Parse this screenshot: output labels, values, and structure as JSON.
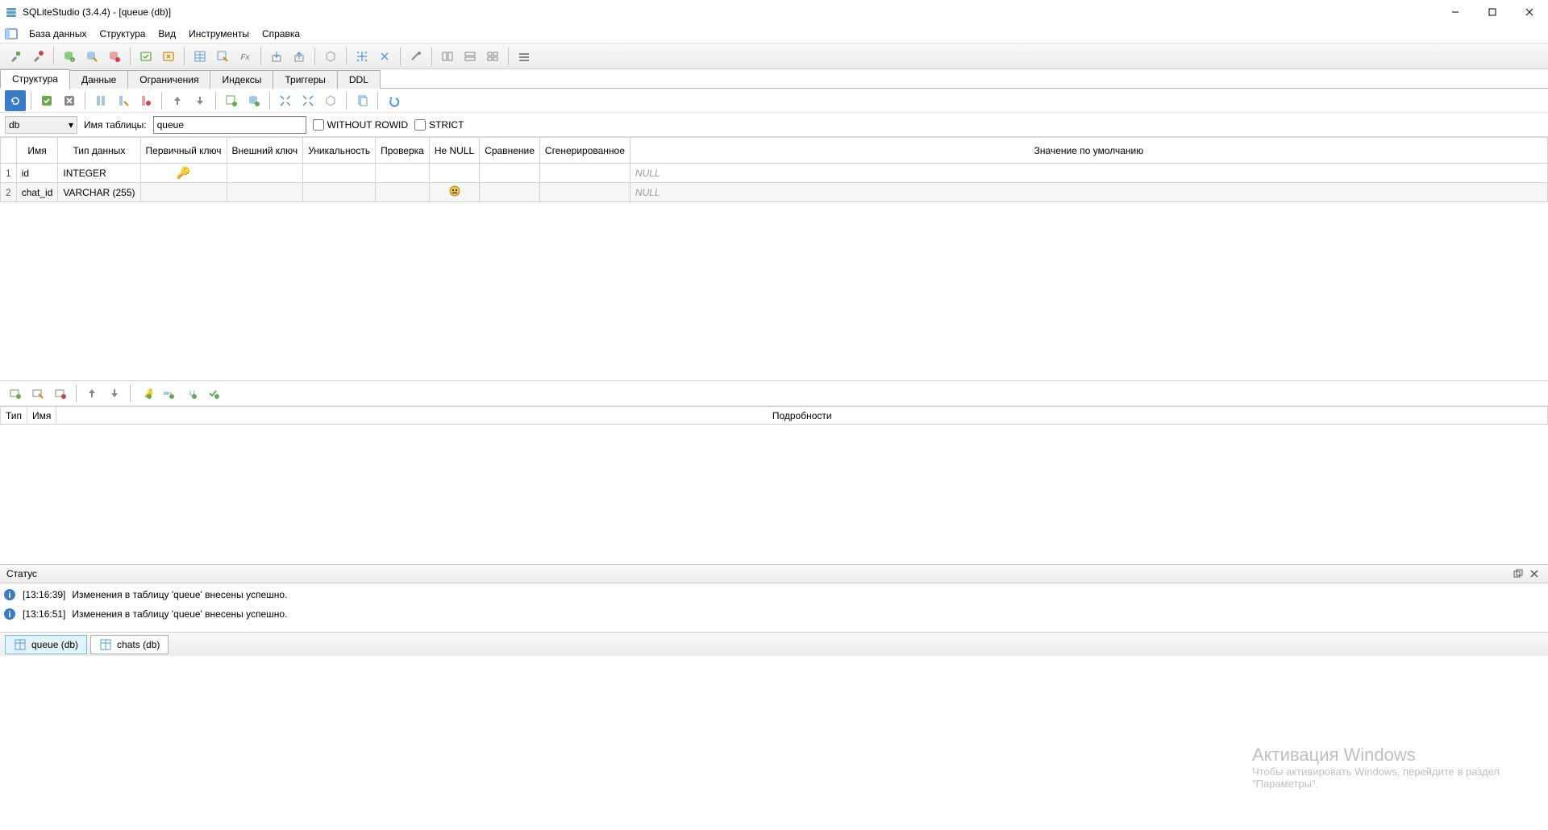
{
  "title": "SQLiteStudio (3.4.4) - [queue (db)]",
  "menu": {
    "database": "База данных",
    "structure": "Структура",
    "view": "Вид",
    "tools": "Инструменты",
    "help": "Справка"
  },
  "tabs": {
    "structure": "Структура",
    "data": "Данные",
    "constraints": "Ограничения",
    "indexes": "Индексы",
    "triggers": "Триггеры",
    "ddl": "DDL"
  },
  "db_selector": "db",
  "table_name_label": "Имя таблицы:",
  "table_name_value": "queue",
  "without_rowid_label": "WITHOUT ROWID",
  "strict_label": "STRICT",
  "columns": {
    "headers": {
      "name": "Имя",
      "data_type": "Тип данных",
      "pk": "Первичный ключ",
      "fk": "Внешний ключ",
      "unique": "Уникальность",
      "check": "Проверка",
      "not_null": "Не NULL",
      "collate": "Сравнение",
      "generated": "Сгенерированное",
      "default": "Значение по умолчанию"
    },
    "rows": [
      {
        "n": "1",
        "name": "id",
        "type": "INTEGER",
        "pk": true,
        "not_null": false,
        "default": "NULL"
      },
      {
        "n": "2",
        "name": "chat_id",
        "type": "VARCHAR (255)",
        "pk": false,
        "not_null": true,
        "default": "NULL"
      }
    ]
  },
  "constraints_headers": {
    "type": "Тип",
    "name": "Имя",
    "details": "Подробности"
  },
  "status": {
    "title": "Статус",
    "lines": [
      {
        "time": "[13:16:39]",
        "msg": "Изменения в таблицу 'queue' внесены успешно."
      },
      {
        "time": "[13:16:51]",
        "msg": "Изменения в таблицу 'queue' внесены успешно."
      }
    ]
  },
  "tasks": {
    "queue": "queue (db)",
    "chats": "chats (db)"
  },
  "watermark": {
    "big": "Активация Windows",
    "small1": "Чтобы активировать Windows, перейдите в раздел",
    "small2": "\"Параметры\"."
  }
}
